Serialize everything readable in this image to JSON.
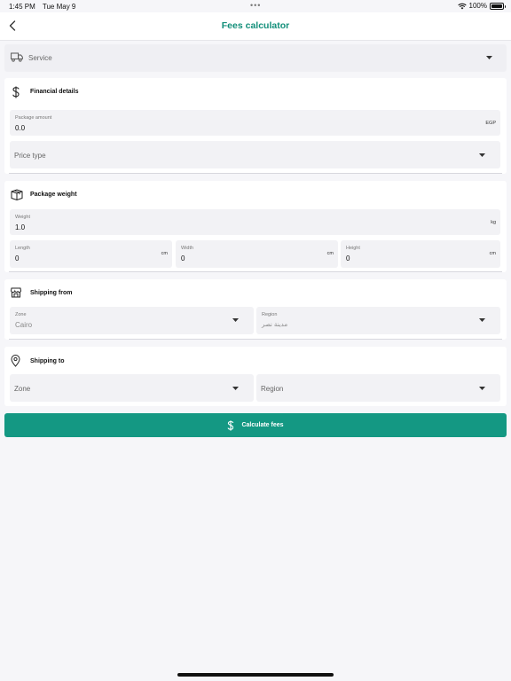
{
  "status_bar": {
    "time": "1:45 PM",
    "date": "Tue May 9",
    "dots": "•••",
    "battery": "100%"
  },
  "nav": {
    "title": "Fees calculator",
    "back_icon": "chevron-left-icon"
  },
  "service": {
    "placeholder": "Service",
    "icon": "truck-icon"
  },
  "financial": {
    "title": "Financial details",
    "icon": "dollar-icon",
    "package_amount": {
      "label": "Package amount",
      "value": "0.0",
      "suffix": "EGP"
    },
    "price_type": {
      "placeholder": "Price type"
    }
  },
  "package_weight": {
    "title": "Package weight",
    "icon": "package-icon",
    "weight": {
      "label": "Weight",
      "value": "1.0",
      "suffix": "kg"
    },
    "length": {
      "label": "Length",
      "value": "0",
      "suffix": "cm"
    },
    "width": {
      "label": "Width",
      "value": "0",
      "suffix": "cm"
    },
    "height": {
      "label": "Height",
      "value": "0",
      "suffix": "cm"
    }
  },
  "shipping_from": {
    "title": "Shipping from",
    "icon": "store-icon",
    "zone": {
      "label": "Zone",
      "value": "Cairo"
    },
    "region": {
      "label": "Region",
      "value": "مدينة نصر"
    }
  },
  "shipping_to": {
    "title": "Shipping to",
    "icon": "location-pin-icon",
    "zone": {
      "placeholder": "Zone"
    },
    "region": {
      "placeholder": "Region"
    }
  },
  "calculate_button": {
    "label": "Calculate fees",
    "icon": "dollar-icon"
  },
  "colors": {
    "accent": "#149883",
    "title": "#138f7a",
    "background": "#f6f6f9",
    "field": "#f2f2f5"
  }
}
